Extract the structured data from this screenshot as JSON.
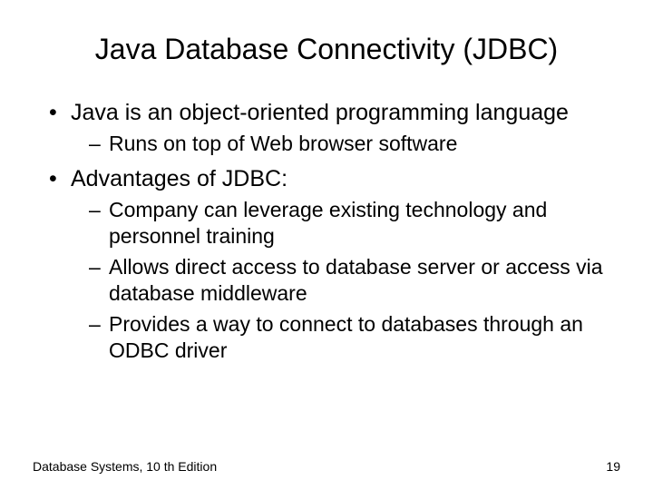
{
  "title": "Java Database Connectivity (JDBC)",
  "bullets": [
    {
      "text": "Java is an object-oriented programming language",
      "sub": [
        "Runs on top of Web browser software"
      ]
    },
    {
      "text": "Advantages of JDBC:",
      "sub": [
        "Company can leverage existing technology and personnel training",
        "Allows direct access to database server or access via database middleware",
        "Provides a way to connect to databases through an ODBC driver"
      ]
    }
  ],
  "footer": {
    "left": "Database Systems, 10 th Edition",
    "right": "19"
  }
}
